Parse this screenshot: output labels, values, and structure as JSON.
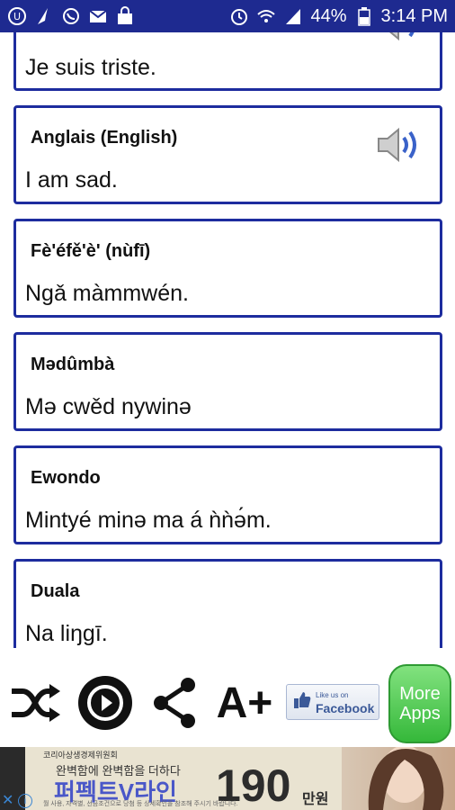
{
  "status_bar": {
    "battery": "44%",
    "time": "3:14 PM",
    "icons_left": [
      "app-icon",
      "broom-icon",
      "whatsapp-icon",
      "mail-icon",
      "bag-icon"
    ],
    "icons_right": [
      "alarm-icon",
      "wifi-icon",
      "signal-icon",
      "battery-icon"
    ]
  },
  "cards": [
    {
      "lang": "",
      "phrase": "Je suis triste.",
      "has_speaker": true
    },
    {
      "lang": "Anglais (English)",
      "phrase": "I am sad.",
      "has_speaker": true
    },
    {
      "lang": "Fè'éfě'è' (nùfī)",
      "phrase": "Ngǎ màmmwén.",
      "has_speaker": false
    },
    {
      "lang": "Mədûmbà",
      "phrase": "Mə cwěd nywinə",
      "has_speaker": false
    },
    {
      "lang": "Ewondo",
      "phrase": "Mintyé minə ma á ǹǹə́m.",
      "has_speaker": false
    },
    {
      "lang": "Duala",
      "phrase": "Na liŋgī.",
      "has_speaker": false
    }
  ],
  "toolbar": {
    "font_plus": "A+",
    "facebook_small": "Like us on",
    "facebook_big": "Facebook",
    "more_apps_line1": "More",
    "more_apps_line2": "Apps"
  },
  "ad": {
    "brand": "코리아상생경제위원회",
    "line1": "완벽함에 완벽함을 더하다",
    "line2": "퍼펙트V라인",
    "number": "190",
    "unit": "만원",
    "fine": "월 사용, 자격별, 선금조건으로 당첨 등 상세확인을 참조해 주시기 바랍니다."
  },
  "colors": {
    "status_bar": "#1e2a90",
    "card_border": "#1d2c9e",
    "more_apps": "#35b83a"
  }
}
